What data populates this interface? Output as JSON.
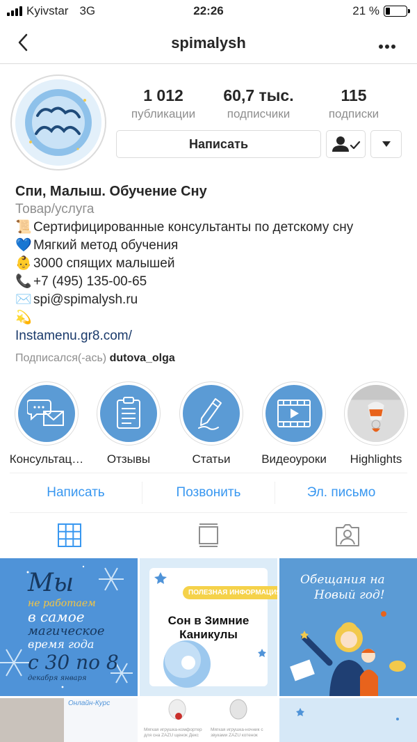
{
  "status_bar": {
    "carrier": "Kyivstar",
    "network": "3G",
    "time": "22:26",
    "battery": "21 %"
  },
  "nav": {
    "title": "spimalysh"
  },
  "stats": [
    {
      "value": "1 012",
      "label": "публикации"
    },
    {
      "value": "60,7 тыс.",
      "label": "подписчики"
    },
    {
      "value": "115",
      "label": "подписки"
    }
  ],
  "actions": {
    "message_label": "Написать"
  },
  "bio": {
    "name": "Спи, Малыш. Обучение Сну",
    "category": "Товар/услуга",
    "lines": [
      {
        "emoji": "📜",
        "text": "Сертифицированные консультанты по детскому сну"
      },
      {
        "emoji": "💙",
        "text": "Мягкий метод обучения"
      },
      {
        "emoji": "👶",
        "text": "3000 спящих малышей"
      },
      {
        "emoji": "📞",
        "text": "+7 (495) 135-00-65"
      },
      {
        "emoji": "✉️",
        "text": "spi@spimalysh.ru"
      },
      {
        "emoji": "💫",
        "text": ""
      }
    ],
    "link": "Instamenu.gr8.com/",
    "followed_prefix": "Подписался(-ась)",
    "followed_user": "dutova_olga"
  },
  "highlights": [
    {
      "label": "Консультац…",
      "icon": "chat-mail-icon"
    },
    {
      "label": "Отзывы",
      "icon": "clipboard-icon"
    },
    {
      "label": "Статьи",
      "icon": "pencil-icon"
    },
    {
      "label": "Видеоуроки",
      "icon": "video-icon"
    },
    {
      "label": "Highlights",
      "icon": "toy-photo"
    }
  ],
  "contacts": {
    "message": "Написать",
    "call": "Позвонить",
    "email": "Эл. письмо"
  },
  "tabs": [
    "grid-icon",
    "feed-icon",
    "tagged-icon"
  ],
  "posts": {
    "p1": {
      "line1": "Мы",
      "line2": "не работаем",
      "line3": "в самое",
      "line4": "магическое",
      "line5": "время года",
      "line6": "с 30 по 8",
      "line7": "декабря января"
    },
    "p2": {
      "badge": "ПОЛЕЗНАЯ ИНФОРМАЦИЯ",
      "title1": "Сон в Зимние",
      "title2": "Каникулы"
    },
    "p3": {
      "title1": "Обещания на",
      "title2": "Новый год!"
    },
    "p4": {
      "title": "Онлайн-Курс"
    },
    "p5": {
      "caption1": "Мягкая игрушка-комфортер для сна ZAZU щенок Декс",
      "caption2": "Мягкая игрушка-ночник с звуками ZAZU котенок"
    }
  },
  "colors": {
    "accent": "#3897f0",
    "highlight_blue": "#5b9bd5",
    "grid_blue": "#4a90d9"
  }
}
